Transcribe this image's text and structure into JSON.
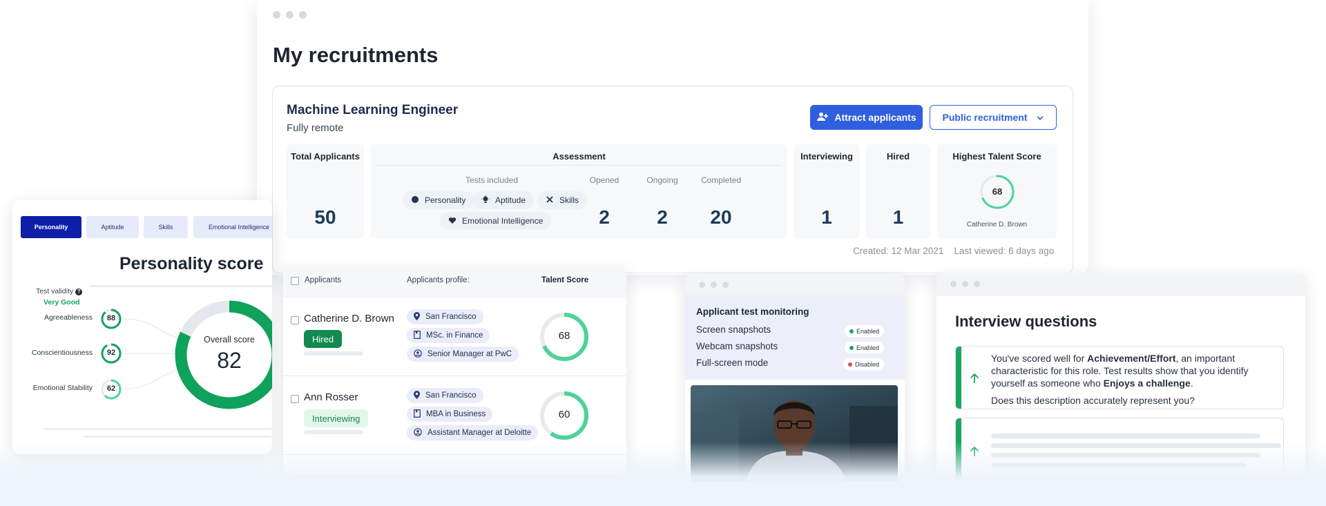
{
  "main": {
    "page_title": "My recruitments",
    "job": {
      "title": "Machine Learning Engineer",
      "subtitle": "Fully remote",
      "attract_label": "Attract applicants",
      "public_label": "Public recruitment"
    },
    "stats": {
      "total_applicants_label": "Total Applicants",
      "total_applicants": "50",
      "assessment_label": "Assessment",
      "tests_included_label": "Tests included",
      "tests": [
        "Personality",
        "Aptitude",
        "Skills",
        "Emotional Intelligence"
      ],
      "opened_label": "Opened",
      "opened": "2",
      "ongoing_label": "Ongoing",
      "ongoing": "2",
      "completed_label": "Completed",
      "completed": "20",
      "interviewing_label": "Interviewing",
      "interviewing": "1",
      "hired_label": "Hired",
      "hired": "1",
      "highest_label": "Highest Talent Score",
      "highest_score": "68",
      "highest_name": "Catherine D. Brown"
    },
    "meta": {
      "created": "Created:  12 Mar 2021",
      "last_viewed": "Last viewed:  6 days ago"
    }
  },
  "applicants": {
    "header_applicants": "Applicants",
    "header_profile": "Applicants profile:",
    "header_score": "Talent Score",
    "rows": [
      {
        "name": "Catherine D. Brown",
        "status": "Hired",
        "location": "San Francisco",
        "education": "MSc. in Finance",
        "role": "Senior Manager at PwC",
        "score": "68",
        "score_value": 68
      },
      {
        "name": "Ann Rosser",
        "status": "Interviewing",
        "location": "San Francisco",
        "education": "MBA in Business",
        "role": "Assistant Manager at Deloitte",
        "score": "60",
        "score_value": 60
      }
    ]
  },
  "personality": {
    "tabs": [
      "Personality",
      "Aptitude",
      "Skills",
      "Emotional Intelligence"
    ],
    "title": "Personality score",
    "validity_label": "Test validity",
    "validity_value": "Very Good",
    "traits": [
      {
        "name": "Agreeableness",
        "score": "88",
        "value": 88
      },
      {
        "name": "Conscientiousness",
        "score": "92",
        "value": 92
      },
      {
        "name": "Emotional Stability",
        "score": "62",
        "value": 62
      }
    ],
    "overall_label": "Overall score",
    "overall_score": "82",
    "overall_value": 82
  },
  "monitoring": {
    "title": "Applicant test monitoring",
    "items": [
      {
        "label": "Screen snapshots",
        "status": "Enabled"
      },
      {
        "label": "Webcam snapshots",
        "status": "Enabled"
      },
      {
        "label": "Full-screen mode",
        "status": "Disabled"
      }
    ],
    "colors": {
      "enabled": "#1aa562",
      "disabled": "#e04848"
    }
  },
  "interview": {
    "title": "Interview questions",
    "q1_intro": "You've scored well for ",
    "q1_bold1": "Achievement/Effort",
    "q1_mid1": ", an important characteristic for this role. Test results show that you identify yourself as someone who ",
    "q1_bold2": "Enjoys a challenge",
    "q1_end": ".",
    "q1_question": "Does this description accurately represent you?"
  },
  "colors": {
    "accent": "#2f5fdf",
    "green": "#1aa562",
    "navy": "#0d1fa8"
  }
}
